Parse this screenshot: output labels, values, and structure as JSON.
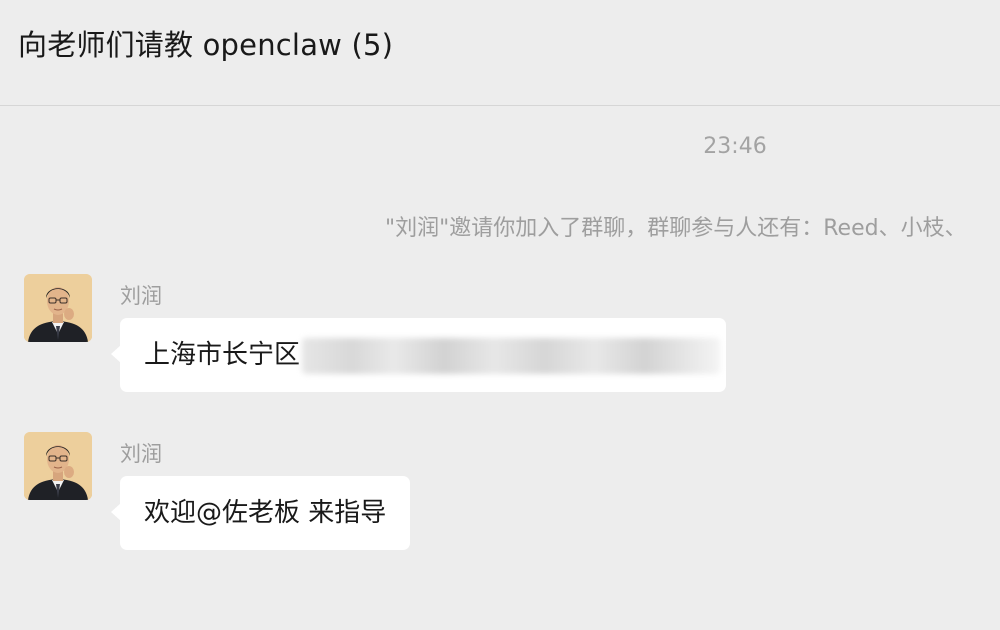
{
  "window": {
    "title": "向老师们请教 openclaw (5)"
  },
  "chat": {
    "timestamp": "23:46",
    "system_notice": "\"刘润\"邀请你加入了群聊，群聊参与人还有：Reed、小枝、",
    "messages": [
      {
        "sender": "刘润",
        "text": "上海市长宁区",
        "redacted": true
      },
      {
        "sender": "刘润",
        "text": "欢迎@佐老板 来指导",
        "redacted": false
      }
    ]
  },
  "icons": {
    "avatar": "user-avatar-photo"
  },
  "colors": {
    "background": "#ededed",
    "bubble": "#ffffff",
    "muted_text": "#9e9e9e",
    "primary_text": "#191919"
  }
}
